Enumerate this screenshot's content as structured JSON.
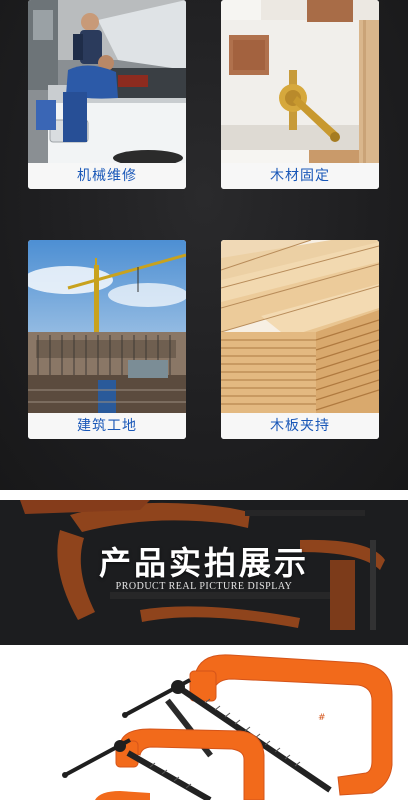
{
  "applications": [
    {
      "label": "机械维修",
      "icon": "mechanic-repair-photo"
    },
    {
      "label": "木材固定",
      "icon": "wood-fixing-photo"
    },
    {
      "label": "建筑工地",
      "icon": "construction-site-photo"
    },
    {
      "label": "木板夹持",
      "icon": "wood-board-clamping-photo"
    }
  ],
  "banner": {
    "title": "产品实拍展示",
    "subtitle": "PRODUCT REAL PICTURE DISPLAY"
  },
  "colors": {
    "label_text": "#1a58b8",
    "clamp_orange": "#f26a1b",
    "background": "#1d1d1f"
  }
}
